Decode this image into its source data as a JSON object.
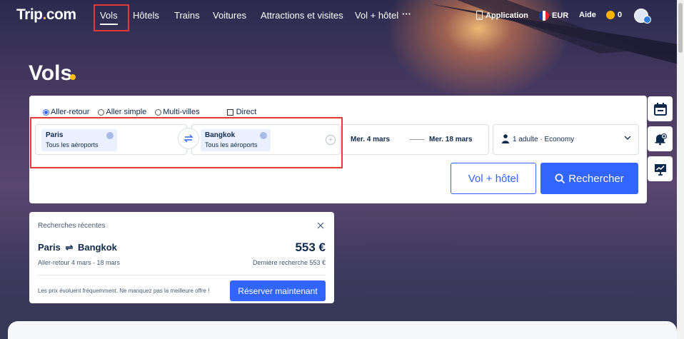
{
  "header": {
    "logo_main": "Trip",
    "logo_dot": ".",
    "logo_suffix": "com",
    "nav": [
      {
        "label": "Vols"
      },
      {
        "label": "Hôtels"
      },
      {
        "label": "Trains"
      },
      {
        "label": "Voitures"
      },
      {
        "label": "Attractions et visites"
      },
      {
        "label": "Vol + hôtel"
      }
    ],
    "more_label": "···",
    "app_label": "Application",
    "currency_label": "EUR",
    "help_label": "Aide",
    "coins_count": "0"
  },
  "page": {
    "title": "Vols"
  },
  "search": {
    "trip_types": [
      "Aller-retour",
      "Aller simple",
      "Multi-villes"
    ],
    "selected_trip_type": "Aller-retour",
    "direct_label": "Direct",
    "from_city": "Paris",
    "from_sub": "Tous les aéroports",
    "to_city": "Bangkok",
    "to_sub": "Tous les aéroports",
    "depart_date": "Mer. 4 mars",
    "return_date": "Mer. 18 mars",
    "passengers": "1 adulte · Economy",
    "flight_hotel_button": "Vol + hôtel",
    "search_button": "Rechercher"
  },
  "side_widgets": [
    "calendar-icon",
    "price-alert-icon",
    "price-trend-icon"
  ],
  "recent": {
    "title": "Recherches récentes",
    "from": "Paris",
    "to": "Bangkok",
    "arrow": "⇌",
    "price": "553 €",
    "trip_info": "Aller-retour  4 mars - 18 mars",
    "last_search": "Dernière recherche 553 €",
    "note": "Les prix évoluent fréquemment. Ne manquez pas la meilleure offre !",
    "book_button": "Réserver maintenant"
  },
  "colors": {
    "accent": "#3264ff",
    "highlight": "#e53935",
    "brand_dot": "#ffc107"
  }
}
